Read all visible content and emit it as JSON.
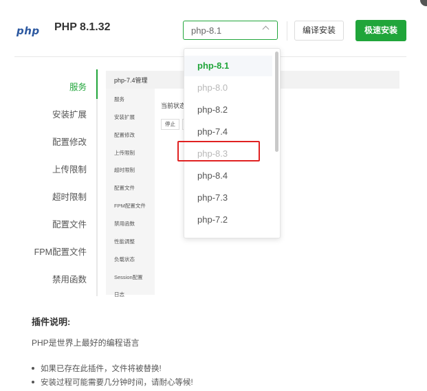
{
  "header": {
    "logo": "php",
    "title": "PHP 8.1.32",
    "version_select": {
      "value": "php-8.1"
    },
    "compile_install_label": "编译安装",
    "fast_install_label": "极速安装"
  },
  "menu": {
    "items": [
      {
        "label": "服务",
        "active": true
      },
      {
        "label": "安装扩展"
      },
      {
        "label": "配置修改"
      },
      {
        "label": "上传限制"
      },
      {
        "label": "超时限制"
      },
      {
        "label": "配置文件"
      },
      {
        "label": "FPM配置文件"
      },
      {
        "label": "禁用函数"
      }
    ]
  },
  "preview": {
    "title": "php-7.4管理",
    "items": [
      "服务",
      "安装扩展",
      "配置修改",
      "上传限制",
      "超时限制",
      "配置文件",
      "FPM配置文件",
      "禁用函数",
      "性能调整",
      "负载状态",
      "Session配置",
      "日志"
    ],
    "status_label": "当前状态",
    "stop_label": "停止"
  },
  "dropdown": {
    "options": [
      {
        "label": "php-8.1",
        "state": "selected"
      },
      {
        "label": "php-8.0",
        "state": "disabled"
      },
      {
        "label": "php-8.2",
        "state": "normal"
      },
      {
        "label": "php-7.4",
        "state": "normal"
      },
      {
        "label": "php-8.3",
        "state": "disabled",
        "highlighted": true
      },
      {
        "label": "php-8.4",
        "state": "normal"
      },
      {
        "label": "php-7.3",
        "state": "normal"
      },
      {
        "label": "php-7.2",
        "state": "normal"
      }
    ]
  },
  "description": {
    "title": "插件说明:",
    "text": "PHP是世界上最好的编程语言",
    "bullets": [
      "如果已存在此插件，文件将被替换!",
      "安装过程可能需要几分钟时间，请耐心等候!"
    ]
  },
  "colors": {
    "accent": "#20a53a",
    "highlight": "#e02020",
    "logo": "#2c58a0"
  }
}
